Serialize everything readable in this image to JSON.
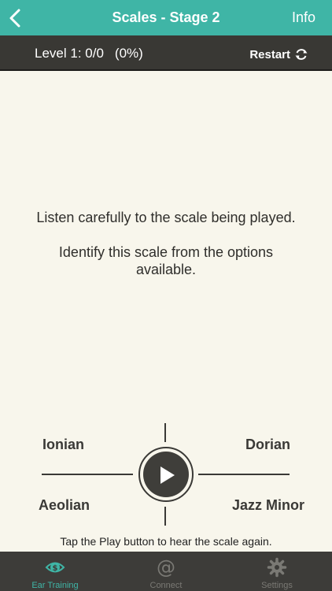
{
  "nav": {
    "title": "Scales - Stage 2",
    "info_label": "Info",
    "back_icon": "chevron-left-icon"
  },
  "status": {
    "level": "Level 1: 0/0",
    "percent": "(0%)",
    "restart_label": "Restart",
    "restart_icon": "refresh-icon"
  },
  "instructions": {
    "line1": "Listen carefully to the scale being played.",
    "line2": "Identify this scale from the options available."
  },
  "options": [
    "Ionian",
    "Dorian",
    "Aeolian",
    "Jazz Minor"
  ],
  "play": {
    "icon": "play-icon"
  },
  "hint": "Tap the Play button to hear the scale again.",
  "tabs": [
    {
      "label": "Ear Training",
      "icon": "ear-training-icon",
      "active": true
    },
    {
      "label": "Connect",
      "icon": "at-sign-icon",
      "active": false
    },
    {
      "label": "Settings",
      "icon": "gear-icon",
      "active": false
    }
  ],
  "colors": {
    "accent": "#3fb5a6",
    "dark": "#393834",
    "background": "#f8f6ec"
  }
}
